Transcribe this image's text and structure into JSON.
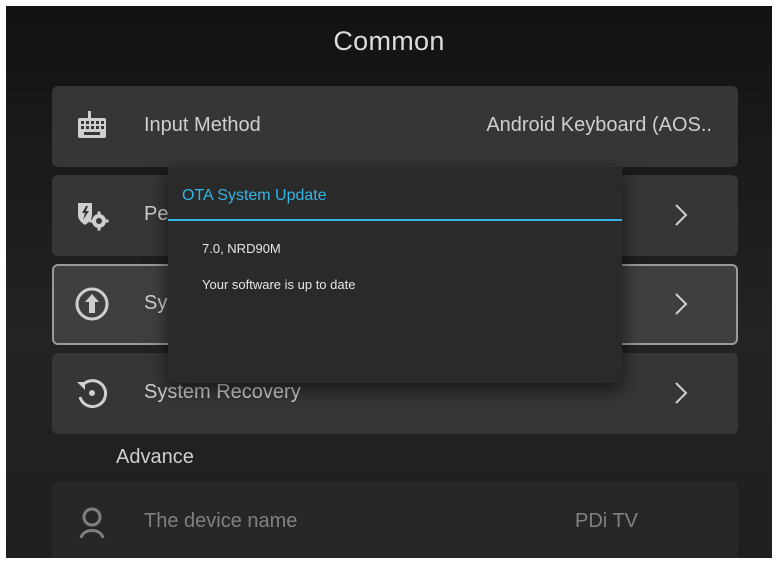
{
  "header": {
    "title": "Common"
  },
  "rows": [
    {
      "label": "Input Method",
      "value": "Android Keyboard (AOS..",
      "icon": "keyboard-icon"
    },
    {
      "label": "Pe",
      "icon": "permissions-gears-icon"
    },
    {
      "label": "Sy",
      "icon": "system-update-icon"
    },
    {
      "label": "System Recovery",
      "icon": "recovery-icon"
    }
  ],
  "advance": {
    "header": "Advance",
    "device_name": {
      "label": "The device name",
      "value": "PDi TV",
      "icon": "search-icon"
    }
  },
  "dialog": {
    "title": "OTA System Update",
    "version": "7.0, NRD90M",
    "status": "Your software is up to date"
  },
  "colors": {
    "accent": "#33b5e5",
    "row_bg": "#363636",
    "dialog_bg": "#2a2a2a"
  }
}
